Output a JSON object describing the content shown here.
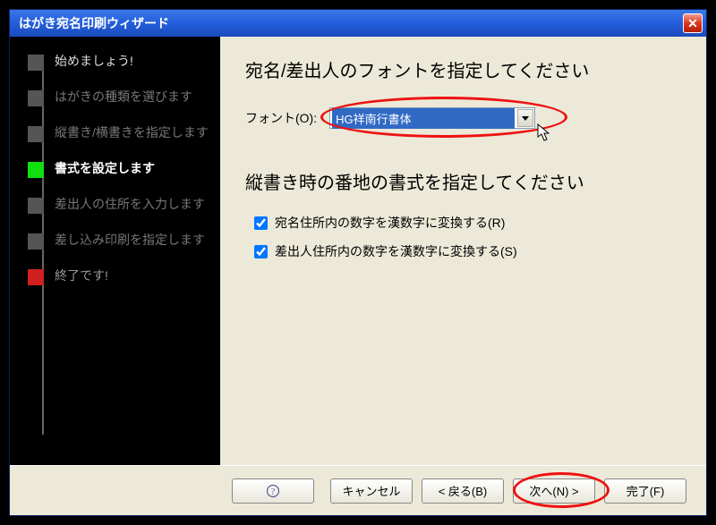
{
  "title": "はがき宛名印刷ウィザード",
  "close_x": "✕",
  "sidebar": {
    "steps": [
      {
        "label": "始めましょう!"
      },
      {
        "label": "はがきの種類を選びます"
      },
      {
        "label": "縦書き/横書きを指定します"
      },
      {
        "label": "書式を設定します"
      },
      {
        "label": "差出人の住所を入力します"
      },
      {
        "label": "差し込み印刷を指定します"
      },
      {
        "label": "終了です!"
      }
    ]
  },
  "main": {
    "heading1": "宛名/差出人のフォントを指定してください",
    "font_label": "フォント(O):",
    "font_value": "HG祥南行書体",
    "heading2": "縦書き時の番地の書式を指定してください",
    "check1": "宛名住所内の数字を漢数字に変換する(R)",
    "check2": "差出人住所内の数字を漢数字に変換する(S)"
  },
  "footer": {
    "help": "?",
    "cancel": "キャンセル",
    "back": "< 戻る(B)",
    "next": "次へ(N) >",
    "finish": "完了(F)"
  }
}
